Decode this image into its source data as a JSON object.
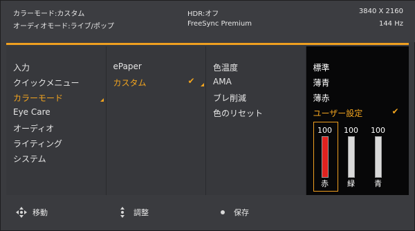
{
  "header": {
    "color_mode": "カラーモード:カスタム",
    "audio_mode": "オーディオモード:ライブ/ポップ",
    "hdr": "HDR:オフ",
    "freesync": "FreeSync Premium",
    "resolution": "3840 X 2160",
    "refresh": "144 Hz"
  },
  "menu": {
    "items": [
      "入力",
      "クイックメニュー",
      "カラーモード",
      "Eye Care",
      "オーディオ",
      "ライティング",
      "システム"
    ],
    "selected_index": 2
  },
  "submenu": {
    "items": [
      "ePaper",
      "カスタム"
    ],
    "selected_index": 1
  },
  "options": {
    "items": [
      "色温度",
      "AMA",
      "ブレ削減",
      "色のリセット"
    ]
  },
  "color_temp": {
    "items": [
      "標準",
      "薄青",
      "薄赤",
      "ユーザー設定"
    ],
    "selected_index": 3,
    "sliders": [
      {
        "label": "赤",
        "value": "100",
        "level": 1.0,
        "color": "#e0221f"
      },
      {
        "label": "緑",
        "value": "100",
        "level": 1.0,
        "color": "#d9d9d9"
      },
      {
        "label": "青",
        "value": "100",
        "level": 1.0,
        "color": "#d9d9d9"
      }
    ]
  },
  "footer": {
    "move": "移動",
    "adjust": "調整",
    "save": "保存",
    "icons": [
      "dpad-four-way-icon",
      "dpad-vertical-icon",
      "dpad-press-icon"
    ]
  },
  "colors": {
    "accent": "#f3a51f",
    "panel": "#37383c",
    "dark_panel": "#070708"
  }
}
